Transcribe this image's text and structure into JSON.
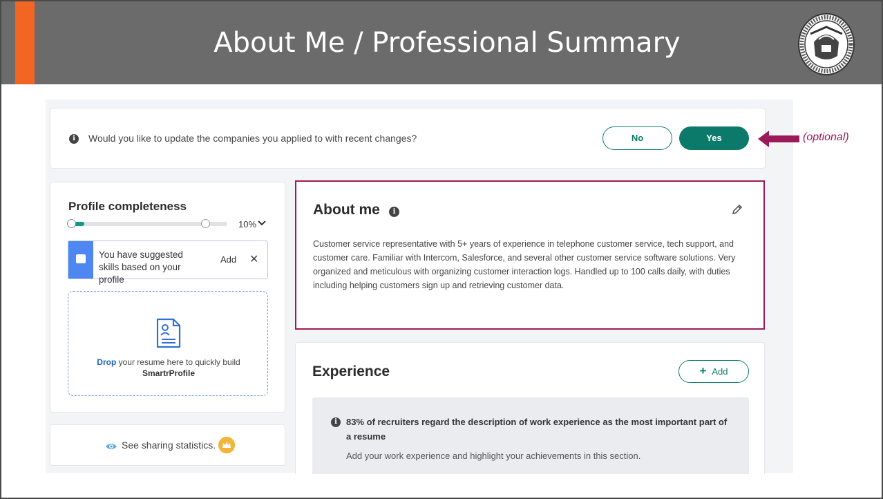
{
  "slide": {
    "title": "About Me / Professional Summary",
    "annotation": "(optional)"
  },
  "banner": {
    "question": "Would you like to update the companies you applied to with recent changes?",
    "no_label": "No",
    "yes_label": "Yes"
  },
  "profile": {
    "title": "Profile completeness",
    "progress_percent": 10,
    "progress_label": "10%",
    "skills_text": "You have suggested skills based on your profile",
    "skills_add": "Add",
    "skills_close": "✕",
    "drop_bold": "Drop",
    "drop_text": " your resume here to quickly build",
    "drop_brand": "SmartrProfile"
  },
  "sharing": {
    "text": "See sharing statistics."
  },
  "about": {
    "title": "About me",
    "body": "Customer service representative with 5+ years of experience in telephone customer service, tech support, and customer care. Familiar with Intercom, Salesforce, and several other customer service software solutions. Very organized and meticulous with organizing customer interaction logs. Handled up to 100 calls daily, with duties including helping customers sign up and retrieving customer data."
  },
  "experience": {
    "title": "Experience",
    "add_label": "Add",
    "tip_head": "83% of recruiters regard the description of work experience as the most important part of a resume",
    "tip_sub": "Add your work experience and highlight your achievements in this section."
  },
  "colors": {
    "header_bg": "#6b6b6b",
    "header_accent": "#f26522",
    "brand_teal": "#0c7a6a",
    "highlight_magenta": "#9b1b5a",
    "skills_blue": "#4e87f2"
  },
  "icons": [
    "info-icon",
    "chevron-down-icon",
    "chat-icon",
    "close-icon",
    "document-person-icon",
    "eye-icon",
    "crown-icon",
    "pencil-icon",
    "plus-icon",
    "arrow-left-icon",
    "city-seal-logo"
  ]
}
